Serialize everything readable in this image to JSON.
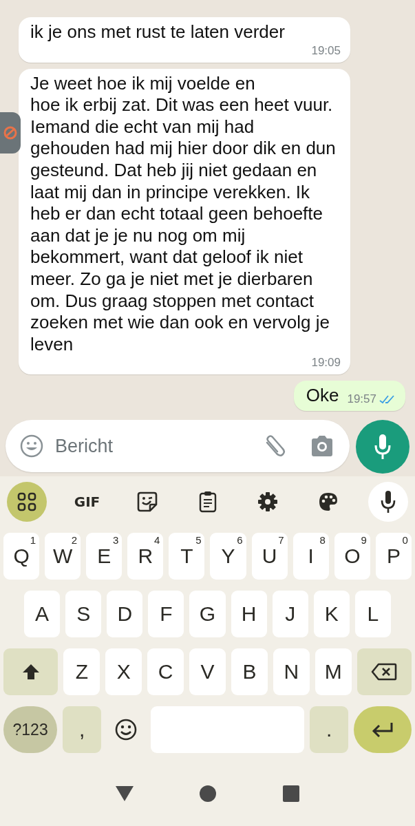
{
  "messages": [
    {
      "kind": "incoming",
      "text": "ik je ons met rust te laten verder",
      "time": "19:05"
    },
    {
      "kind": "incoming",
      "text": "Je weet hoe ik mij voelde en\nhoe ik erbij zat. Dit was een heet vuur. Iemand die echt van mij had gehouden had mij hier door dik en dun gesteund. Dat heb jij niet gedaan en laat mij dan in principe verekken. Ik heb er dan echt totaal geen behoefte aan dat je je nu nog om mij bekommert, want dat geloof ik niet meer. Zo ga je niet met je dierbaren om. Dus graag stoppen met contact zoeken met wie dan ook en vervolg je leven",
      "time": "19:09"
    },
    {
      "kind": "outgoing",
      "text": "Oke",
      "time": "19:57",
      "read": true
    }
  ],
  "composer": {
    "placeholder": "Bericht"
  },
  "keyboard": {
    "toolbar": [
      {
        "kind": "apps",
        "selected": true
      },
      {
        "kind": "gif",
        "label": "GIF",
        "selected": false
      },
      {
        "kind": "sticker",
        "selected": false
      },
      {
        "kind": "clipboard",
        "selected": false
      },
      {
        "kind": "settings",
        "selected": false
      },
      {
        "kind": "theme",
        "selected": false
      },
      {
        "kind": "voice",
        "selected": false
      }
    ],
    "rows": [
      {
        "keys": [
          {
            "kind": "letter",
            "label": "Q",
            "hint": "1"
          },
          {
            "kind": "letter",
            "label": "W",
            "hint": "2"
          },
          {
            "kind": "letter",
            "label": "E",
            "hint": "3"
          },
          {
            "kind": "letter",
            "label": "R",
            "hint": "4"
          },
          {
            "kind": "letter",
            "label": "T",
            "hint": "5"
          },
          {
            "kind": "letter",
            "label": "Y",
            "hint": "6"
          },
          {
            "kind": "letter",
            "label": "U",
            "hint": "7"
          },
          {
            "kind": "letter",
            "label": "I",
            "hint": "8"
          },
          {
            "kind": "letter",
            "label": "O",
            "hint": "9"
          },
          {
            "kind": "letter",
            "label": "P",
            "hint": "0"
          }
        ]
      },
      {
        "keys": [
          {
            "kind": "letter",
            "label": "A"
          },
          {
            "kind": "letter",
            "label": "S"
          },
          {
            "kind": "letter",
            "label": "D"
          },
          {
            "kind": "letter",
            "label": "F"
          },
          {
            "kind": "letter",
            "label": "G"
          },
          {
            "kind": "letter",
            "label": "H"
          },
          {
            "kind": "letter",
            "label": "J"
          },
          {
            "kind": "letter",
            "label": "K"
          },
          {
            "kind": "letter",
            "label": "L"
          }
        ]
      },
      {
        "keys": [
          {
            "kind": "shift"
          },
          {
            "kind": "letter",
            "label": "Z"
          },
          {
            "kind": "letter",
            "label": "X"
          },
          {
            "kind": "letter",
            "label": "C"
          },
          {
            "kind": "letter",
            "label": "V"
          },
          {
            "kind": "letter",
            "label": "B"
          },
          {
            "kind": "letter",
            "label": "N"
          },
          {
            "kind": "letter",
            "label": "M"
          },
          {
            "kind": "backspace"
          }
        ]
      },
      {
        "keys": [
          {
            "kind": "symbols",
            "label": "?123"
          },
          {
            "kind": "punct",
            "label": ","
          },
          {
            "kind": "emoji"
          },
          {
            "kind": "space"
          },
          {
            "kind": "punct",
            "label": "."
          },
          {
            "kind": "enter"
          }
        ]
      }
    ]
  }
}
